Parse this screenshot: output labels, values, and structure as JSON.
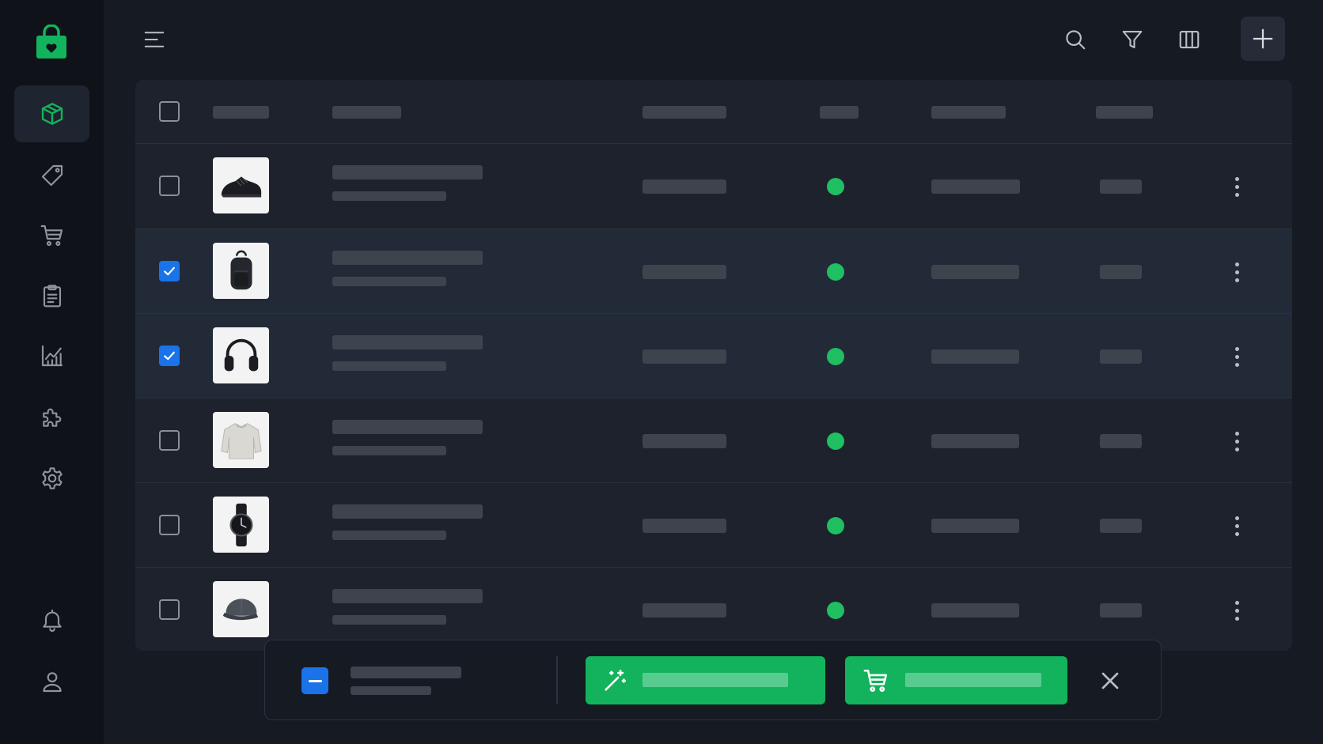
{
  "app": {
    "brand_color": "#12b35c",
    "accent_color": "#1a73e8"
  },
  "sidebar": {
    "logo_icon": "shopping-bag-heart-icon",
    "items": [
      {
        "icon": "cube-icon",
        "active": true
      },
      {
        "icon": "tag-icon",
        "active": false
      },
      {
        "icon": "cart-icon",
        "active": false
      },
      {
        "icon": "clipboard-icon",
        "active": false
      },
      {
        "icon": "chart-icon",
        "active": false
      },
      {
        "icon": "puzzle-icon",
        "active": false
      },
      {
        "icon": "settings-gear-icon",
        "active": false
      }
    ],
    "bottom": [
      {
        "icon": "bell-icon"
      },
      {
        "icon": "user-icon"
      }
    ]
  },
  "topbar": {
    "menu_icon": "hamburger-icon",
    "actions": [
      "search-icon",
      "filter-icon",
      "columns-icon",
      "plus-icon"
    ]
  },
  "table": {
    "rows": [
      {
        "product": "sneaker",
        "selected": false,
        "status": "active"
      },
      {
        "product": "backpack",
        "selected": true,
        "status": "active"
      },
      {
        "product": "headphones",
        "selected": true,
        "status": "active"
      },
      {
        "product": "sweatshirt",
        "selected": false,
        "status": "active"
      },
      {
        "product": "watch",
        "selected": false,
        "status": "active"
      },
      {
        "product": "cap",
        "selected": false,
        "status": "active"
      }
    ]
  },
  "bulk_bar": {
    "state": "indeterminate",
    "actions": [
      "magic-wand-icon",
      "cart-icon"
    ],
    "close_icon": "close-icon"
  }
}
